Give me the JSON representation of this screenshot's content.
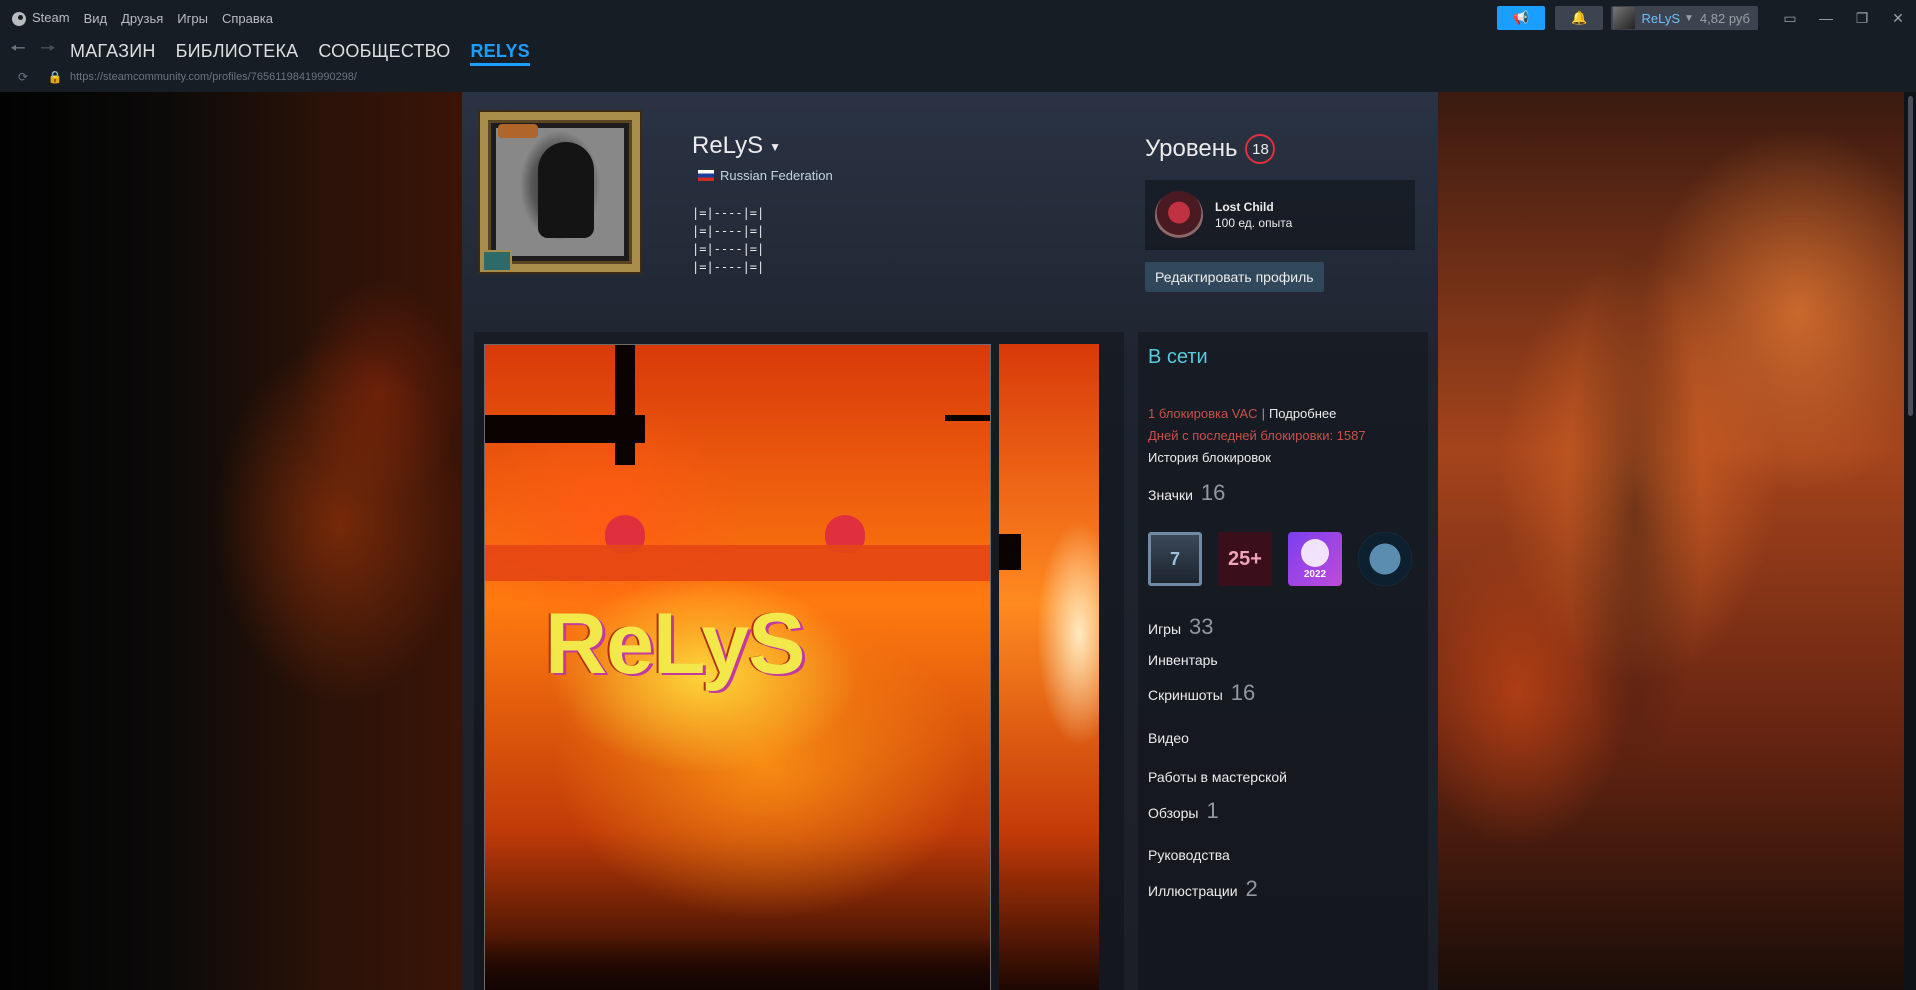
{
  "titlebar": {
    "app_name": "Steam",
    "menu": [
      "Вид",
      "Друзья",
      "Игры",
      "Справка"
    ],
    "account_name": "ReLyS",
    "balance": "4,82 руб"
  },
  "nav": {
    "tabs": [
      "МАГАЗИН",
      "БИБЛИОТЕКА",
      "СООБЩЕСТВО",
      "RELYS"
    ],
    "url": "https://steamcommunity.com/profiles/76561198419990298/"
  },
  "profile": {
    "persona_name": "ReLyS",
    "location": "Russian Federation",
    "summary": [
      "|=|----|=|",
      "|=|----|=|",
      "|=|----|=|",
      "|=|----|=|"
    ],
    "level_label": "Уровень",
    "level": "18",
    "favorite_badge": {
      "name": "Lost Child",
      "xp": "100 ед. опыта"
    },
    "edit_profile": "Редактировать профиль",
    "showcase_title": "ReLyS"
  },
  "sidebar": {
    "status": "В сети",
    "vac_count": "1 блокировка VAC",
    "vac_more": "Подробнее",
    "vac_days": "Дней с последней блокировки: 1587",
    "ban_history": "История блокировок",
    "badges_label": "Значки",
    "badges_count": "16",
    "badges": [
      {
        "icon": "years-of-service-badge",
        "label": "7"
      },
      {
        "icon": "level-25-badge",
        "label": "25+"
      },
      {
        "icon": "steam-replay-badge",
        "label": "2022"
      },
      {
        "icon": "winter-sale-badge",
        "label": ""
      }
    ],
    "stats": [
      {
        "label": "Игры",
        "count": "33"
      },
      {
        "label": "Инвентарь",
        "count": ""
      },
      {
        "label": "Скриншоты",
        "count": "16"
      },
      {
        "label": "Видео",
        "count": ""
      },
      {
        "label": "Работы в мастерской",
        "count": ""
      },
      {
        "label": "Обзоры",
        "count": "1"
      },
      {
        "label": "Руководства",
        "count": ""
      },
      {
        "label": "Иллюстрации",
        "count": "2"
      }
    ]
  },
  "colors": {
    "accent": "#1a9fff",
    "online": "#57cbde",
    "vac": "#c7504a",
    "level_ring": "#e0303d"
  }
}
